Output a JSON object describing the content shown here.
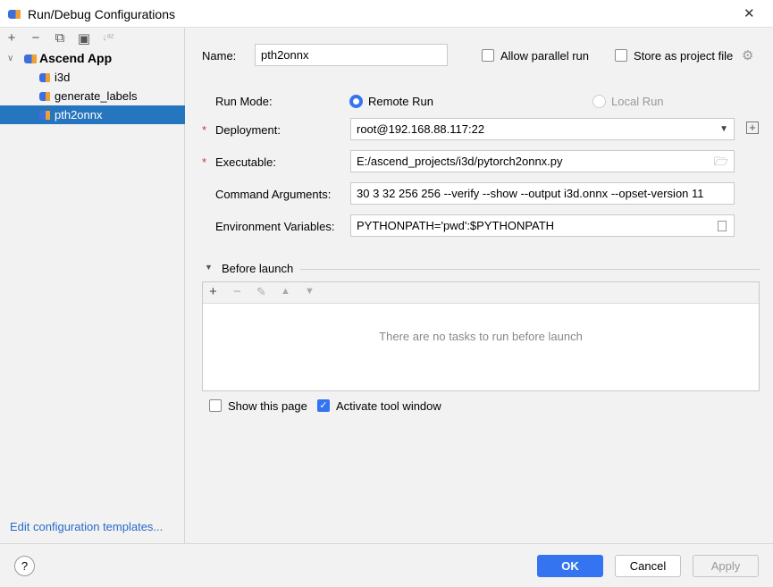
{
  "window": {
    "title": "Run/Debug Configurations",
    "close": "✕"
  },
  "sidebar": {
    "toolbar": [
      "+",
      "−",
      "⧉",
      "▣",
      "↓ᵃᶻ"
    ],
    "tree": [
      {
        "label": "Ascend App",
        "expanded": true
      },
      {
        "label": "i3d"
      },
      {
        "label": "generate_labels"
      },
      {
        "label": "pth2onnx",
        "selected": true
      }
    ],
    "edit_templates": "Edit configuration templates..."
  },
  "form": {
    "name_label": "Name:",
    "name_value": "pth2onnx",
    "allow_parallel": {
      "label": "Allow parallel run",
      "checked": false
    },
    "store_project": {
      "label": "Store as project file",
      "checked": false
    },
    "run_mode_label": "Run Mode:",
    "remote_run": {
      "label": "Remote Run",
      "selected": true
    },
    "local_run": {
      "label": "Local Run",
      "selected": false,
      "disabled": true
    },
    "deployment_label": "Deployment:",
    "deployment_value": "root@192.168.88.117:22",
    "executable_label": "Executable:",
    "executable_value": "E:/ascend_projects/i3d/pytorch2onnx.py",
    "args_label": "Command Arguments:",
    "args_value": "30 3 32 256 256 --verify --show --output i3d.onnx --opset-version 11",
    "env_label": "Environment Variables:",
    "env_value": "PYTHONPATH='pwd':$PYTHONPATH",
    "required_mark": "*"
  },
  "before_launch": {
    "title": "Before launch",
    "empty_text": "There are no tasks to run before launch",
    "toolbar": [
      "+",
      "−",
      "✎",
      "▲",
      "▼"
    ]
  },
  "options": {
    "show_page": {
      "label": "Show this page",
      "checked": false
    },
    "activate_tool": {
      "label": "Activate tool window",
      "checked": true
    }
  },
  "footer": {
    "help": "?",
    "ok": "OK",
    "cancel": "Cancel",
    "apply": "Apply"
  },
  "colors": {
    "accent": "#3574f0",
    "selection": "#2675bf",
    "link": "#2a6ac8"
  }
}
